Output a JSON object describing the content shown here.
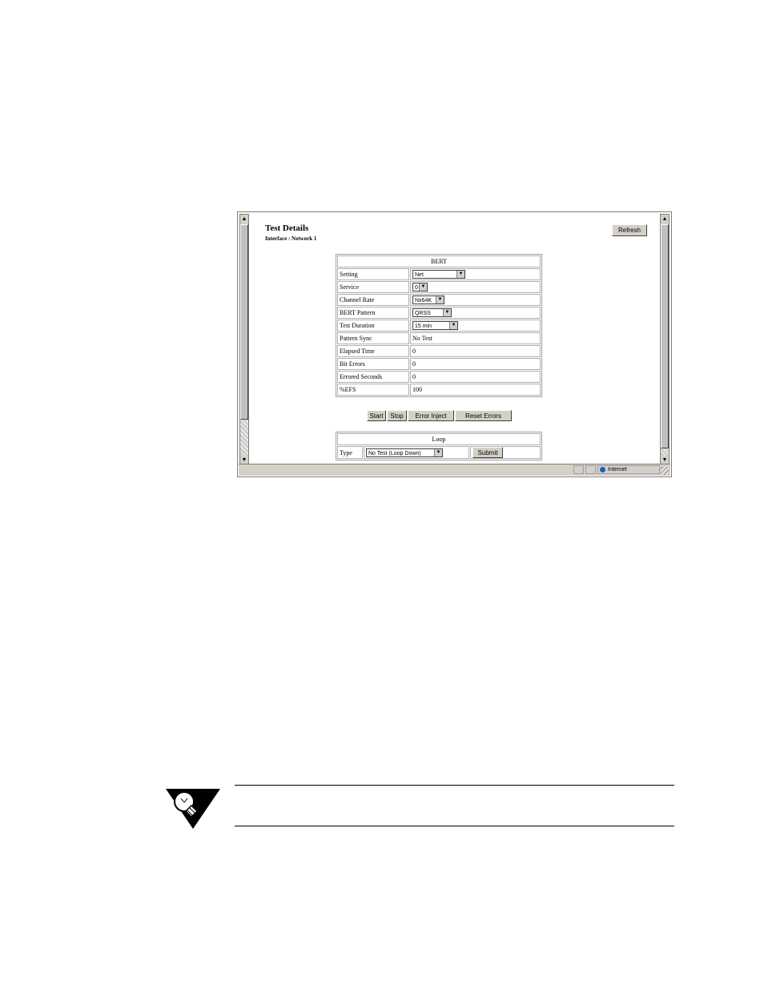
{
  "page": {
    "title": "Test Details",
    "subtitle": "Interface : Network 1",
    "refresh_label": "Refresh"
  },
  "bert": {
    "header": "BERT",
    "rows": [
      {
        "label": "Setting",
        "value": "Net",
        "type": "select"
      },
      {
        "label": "Service",
        "value": "0",
        "type": "select"
      },
      {
        "label": "Channel Rate",
        "value": "Nx64K",
        "type": "select"
      },
      {
        "label": "BERT Pattern",
        "value": "QRSS",
        "type": "select"
      },
      {
        "label": "Test Duration",
        "value": "15 min",
        "type": "select"
      },
      {
        "label": "Pattern Sync",
        "value": "No Test",
        "type": "text"
      },
      {
        "label": "Elapsed Time",
        "value": "0",
        "type": "text"
      },
      {
        "label": "Bit Errors",
        "value": "0",
        "type": "text"
      },
      {
        "label": "Errored Seconds",
        "value": "0",
        "type": "text"
      },
      {
        "label": "%EFS",
        "value": "100",
        "type": "text"
      }
    ]
  },
  "actions": {
    "start": "Start",
    "stop": "Stop",
    "error_inject": "Error Inject",
    "reset_errors": "Reset Errors"
  },
  "loop": {
    "header": "Loop",
    "type_label": "Type",
    "type_value": "No Test (Loop Down)",
    "submit": "Submit"
  },
  "statusbar": {
    "zone": "Internet"
  },
  "icons": {
    "scroll_up": "scroll-up-arrow-icon",
    "scroll_down": "scroll-down-arrow-icon",
    "dropdown": "chevron-down-icon",
    "zone": "globe-icon",
    "note": "lightbulb-icon"
  }
}
